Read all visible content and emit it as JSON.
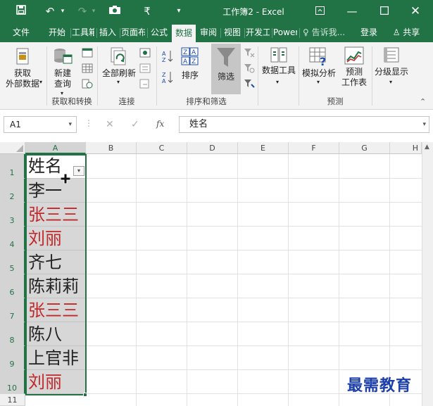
{
  "titlebar": {
    "title": "工作簿2 - Excel",
    "colors": {
      "accent": "#217346"
    }
  },
  "tabs": [
    {
      "label": "文件"
    },
    {
      "label": "开始"
    },
    {
      "label": "工具箱"
    },
    {
      "label": "插入"
    },
    {
      "label": "页面布局"
    },
    {
      "label": "公式"
    },
    {
      "label": "数据",
      "active": true
    },
    {
      "label": "审阅"
    },
    {
      "label": "视图"
    },
    {
      "label": "开发工具"
    },
    {
      "label": "Power Pivot"
    }
  ],
  "tell_me": "告诉我...",
  "login": "登录",
  "share": "共享",
  "ribbon": {
    "get_external": "获取\n外部数据",
    "new_query": "新建\n查询",
    "refresh_all": "全部刷新",
    "sort": "排序",
    "filter": "筛选",
    "data_tools": "数据工具",
    "whatif": "模拟分析",
    "forecast": "预测\n工作表",
    "outline": "分级显示",
    "group_get": "获取和转换",
    "group_conn": "连接",
    "group_sort": "排序和筛选",
    "group_forecast": "预测"
  },
  "formula_bar": {
    "name_box": "A1",
    "fx": "fx",
    "value": "姓名"
  },
  "columns": [
    "A",
    "B",
    "C",
    "D",
    "E",
    "F",
    "G",
    "H"
  ],
  "rows": [
    "1",
    "2",
    "3",
    "4",
    "5",
    "6",
    "7",
    "8",
    "9",
    "10",
    "11"
  ],
  "cells": [
    {
      "text": "姓名",
      "color": "#222222"
    },
    {
      "text": "李一",
      "color": "#222222"
    },
    {
      "text": "张三三",
      "color": "#c0282a"
    },
    {
      "text": "刘丽",
      "color": "#c0282a"
    },
    {
      "text": "齐七",
      "color": "#222222"
    },
    {
      "text": "陈莉莉",
      "color": "#222222"
    },
    {
      "text": "张三三",
      "color": "#c0282a"
    },
    {
      "text": "陈八",
      "color": "#222222"
    },
    {
      "text": "上官非",
      "color": "#222222"
    },
    {
      "text": "刘丽",
      "color": "#c0282a"
    }
  ],
  "watermark": "最需教育"
}
